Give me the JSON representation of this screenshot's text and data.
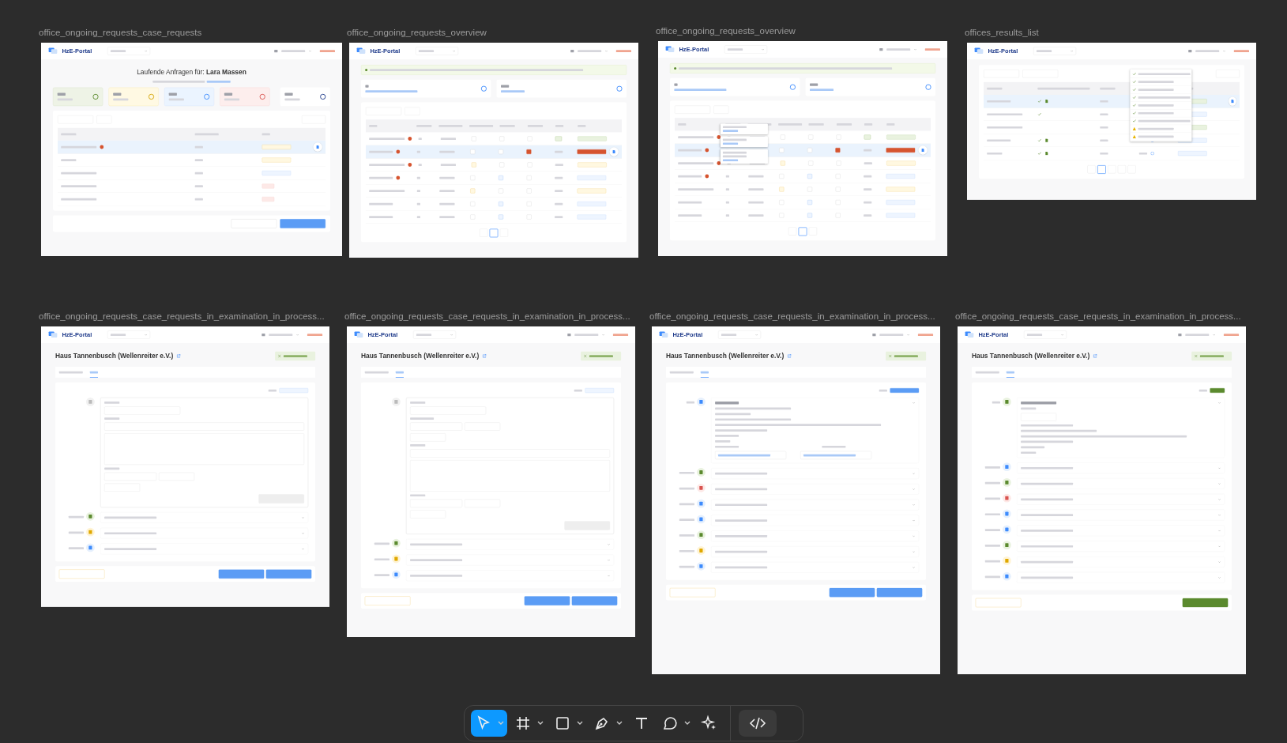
{
  "frames": [
    {
      "title": "office_ongoing_requests_case_requests",
      "kind": "case_requests",
      "brand": "HzE-Portal",
      "heading": "Laufende Anfragen für: **Lara Massen**"
    },
    {
      "title": "office_ongoing_requests_overview",
      "kind": "overview",
      "brand": "HzE-Portal"
    },
    {
      "title": "office_ongoing_requests_overview",
      "kind": "overview_hints",
      "brand": "HzE-Portal"
    },
    {
      "title": "offices_results_list",
      "kind": "results_list",
      "brand": "HzE-Portal"
    },
    {
      "title": "office_ongoing_requests_case_requests_in_examination_in_process...",
      "kind": "detail_message_form",
      "brand": "HzE-Portal",
      "heading": "Haus Tannenbusch (Wellenreiter e.V.)"
    },
    {
      "title": "office_ongoing_requests_case_requests_in_examination_in_process...",
      "kind": "detail_documents_form",
      "brand": "HzE-Portal",
      "heading": "Haus Tannenbusch (Wellenreiter e.V.)"
    },
    {
      "title": "office_ongoing_requests_case_requests_in_examination_in_process...",
      "kind": "detail_meeting",
      "brand": "HzE-Portal",
      "heading": "Haus Tannenbusch (Wellenreiter e.V.)"
    },
    {
      "title": "office_ongoing_requests_case_requests_in_examination_in_process...",
      "kind": "detail_accepted",
      "brand": "HzE-Portal",
      "heading": "Haus Tannenbusch (Wellenreiter e.V.)"
    }
  ],
  "toolbar": {
    "tools": [
      {
        "kind": "move",
        "selected": true,
        "menu": true
      },
      {
        "kind": "frame",
        "selected": false,
        "menu": true
      },
      {
        "kind": "rectangle",
        "selected": false,
        "menu": true
      },
      {
        "kind": "pen",
        "selected": false,
        "menu": true
      },
      {
        "kind": "text",
        "selected": false,
        "menu": false
      },
      {
        "kind": "comment",
        "selected": false,
        "menu": true
      },
      {
        "kind": "actions",
        "selected": false,
        "menu": false
      },
      {
        "kind": "dev_mode",
        "selected": false,
        "menu": false
      }
    ]
  }
}
